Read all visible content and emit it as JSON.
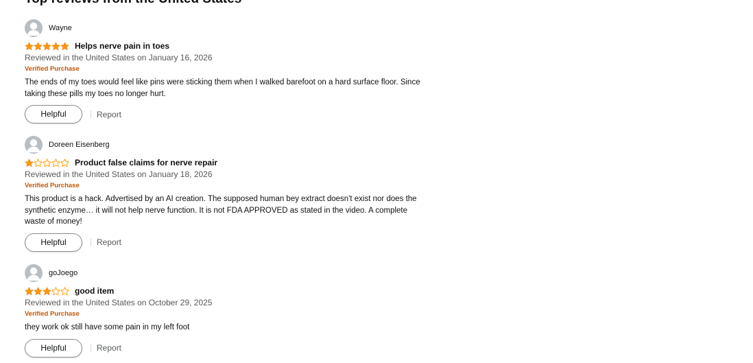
{
  "section": {
    "title": "Top reviews from the United States"
  },
  "colors": {
    "star": "#ff9900",
    "verified": "#c45500",
    "muted": "#565959",
    "avatar": "#b8bec2"
  },
  "reviews": [
    {
      "profile_name": "Wayne",
      "rating": 5,
      "title": "Helps nerve pain in toes",
      "date": "Reviewed in the United States on January 16, 2026",
      "verified": "Verified Purchase",
      "body": "The ends of my toes would feel like pins were sticking them when I walked barefoot on a hard surface floor. Since taking these pills my toes no longer hurt.",
      "helpful_label": "Helpful",
      "report_label": "Report"
    },
    {
      "profile_name": "Doreen Eisenberg",
      "rating": 1,
      "title": "Product false claims for nerve repair",
      "date": "Reviewed in the United States on January 18, 2026",
      "verified": "Verified Purchase",
      "body": "This product is a hack. Advertised by an AI creation. The supposed human bey extract doesn't exist nor does the synthetic enzyme… it will not help nerve function. It is not FDA APPROVED as stated in the video. A complete waste of money!",
      "helpful_label": "Helpful",
      "report_label": "Report"
    },
    {
      "profile_name": "goJoego",
      "rating": 3,
      "title": "good item",
      "date": "Reviewed in the United States on October 29, 2025",
      "verified": "Verified Purchase",
      "body": "they work ok still have some pain in my left foot",
      "helpful_label": "Helpful",
      "report_label": "Report"
    }
  ]
}
